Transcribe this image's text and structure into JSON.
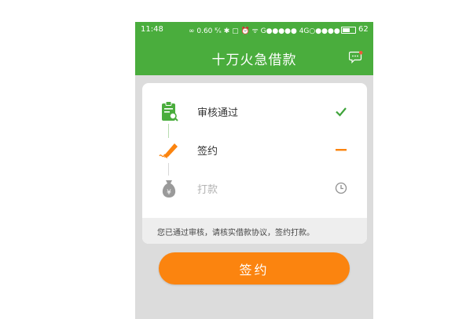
{
  "status_bar": {
    "time": "11:48",
    "indicators": "∞  0.60 ᴷ⁄ₛ ✱ ▢ ⏰ ᯤ  G●●●●● 4G○●●●●",
    "battery_level": "62",
    "battery_fraction": 0.62
  },
  "header": {
    "title": "十万火急借款",
    "message_icon": "chat-bubble-icon"
  },
  "steps": [
    {
      "label": "审核通过",
      "icon": "clipboard-search-icon",
      "state": "done",
      "state_icon": "check-icon"
    },
    {
      "label": "签约",
      "icon": "pen-sign-icon",
      "state": "current",
      "state_icon": "dash-icon"
    },
    {
      "label": "打款",
      "icon": "money-bag-icon",
      "state": "pending",
      "state_icon": "clock-icon"
    }
  ],
  "hint": "您已通过审核，请核实借款协议，签约打款。",
  "sign_button": "签约",
  "colors": {
    "brand_green": "#4aad3d",
    "accent_orange": "#fb840f",
    "check_green": "#3ea33a",
    "muted_grey": "#b3b3b3",
    "page_grey": "#dcdcdc"
  }
}
